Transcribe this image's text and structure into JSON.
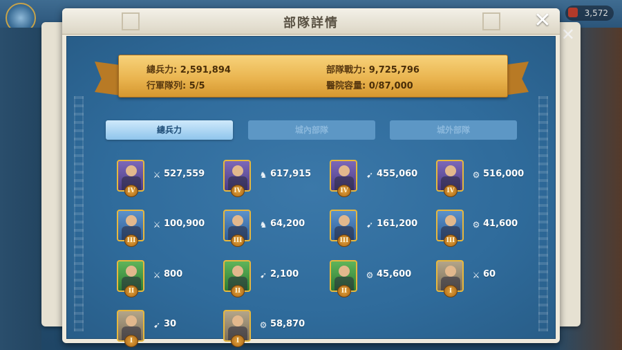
{
  "background": {
    "resource_value": "3,572"
  },
  "dialog": {
    "title": "部隊詳情",
    "close_icon": "close-icon",
    "stats": {
      "total_troops_label": "總兵力:",
      "total_troops_value": "2,591,894",
      "troop_power_label": "部隊戰力:",
      "troop_power_value": "9,725,796",
      "march_queue_label": "行軍隊列:",
      "march_queue_value": "5/5",
      "hospital_label": "醫院容量:",
      "hospital_value": "0/87,000"
    },
    "tabs": [
      {
        "label": "總兵力",
        "active": true
      },
      {
        "label": "城內部隊",
        "active": false
      },
      {
        "label": "城外部隊",
        "active": false
      }
    ]
  },
  "troops": [
    {
      "tier": "IV",
      "type": "infantry-icon",
      "count": "527,559"
    },
    {
      "tier": "IV",
      "type": "cavalry-icon",
      "count": "617,915"
    },
    {
      "tier": "IV",
      "type": "archer-icon",
      "count": "455,060"
    },
    {
      "tier": "IV",
      "type": "siege-icon",
      "count": "516,000"
    },
    {
      "tier": "III",
      "type": "infantry-icon",
      "count": "100,900"
    },
    {
      "tier": "III",
      "type": "cavalry-icon",
      "count": "64,200"
    },
    {
      "tier": "III",
      "type": "archer-icon",
      "count": "161,200"
    },
    {
      "tier": "III",
      "type": "siege-icon",
      "count": "41,600"
    },
    {
      "tier": "II",
      "type": "infantry-icon",
      "count": "800"
    },
    {
      "tier": "II",
      "type": "archer-icon",
      "count": "2,100"
    },
    {
      "tier": "II",
      "type": "siege-icon",
      "count": "45,600"
    },
    {
      "tier": "I",
      "type": "infantry-icon",
      "count": "60"
    },
    {
      "tier": "I",
      "type": "archer-icon",
      "count": "30"
    },
    {
      "tier": "I",
      "type": "siege-icon",
      "count": "58,870"
    }
  ],
  "colors": {
    "panel_blue": "#2f6b9b",
    "ribbon_gold": "#eab550",
    "tab_active": "#8fc5ec",
    "tab_inactive": "#5d97c5",
    "frame_gold": "#e8b83d"
  }
}
